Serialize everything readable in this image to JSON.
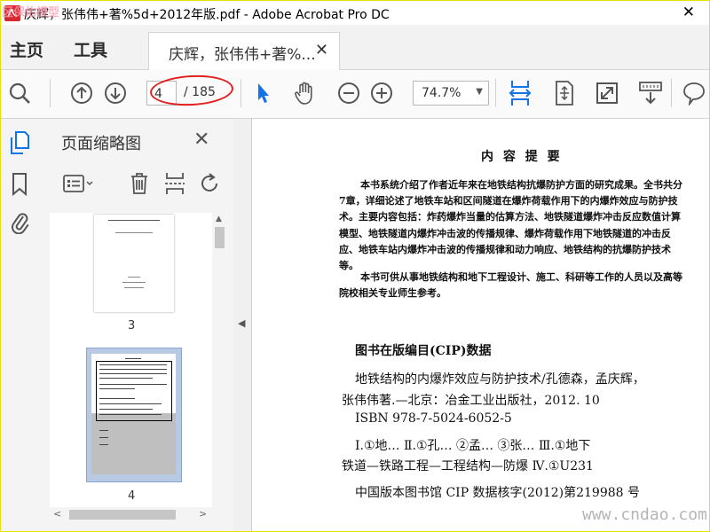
{
  "window": {
    "title": "庆辉，张伟伟+著%5d+2012年版.pdf - Adobe Acrobat Pro DC",
    "close_glyph": "✕",
    "watermark_top": "区保佑模型"
  },
  "tabs": {
    "home": "主页",
    "tools": "工具",
    "document": "庆辉，张伟伟+著%...",
    "close_glyph": "✕"
  },
  "toolbar": {
    "current_page": "4",
    "total_pages": "/ 185",
    "zoom": "74.7%",
    "icons": [
      "search-icon",
      "page-up-icon",
      "page-down-icon",
      "select-arrow-icon",
      "hand-icon",
      "zoom-out-icon",
      "zoom-in-icon",
      "fit-width-icon",
      "full-page-icon",
      "fullscreen-icon",
      "scroll-mode-icon",
      "comment-icon"
    ]
  },
  "left_rail": {
    "icons": [
      "pages-icon",
      "bookmark-icon",
      "attachment-icon"
    ]
  },
  "thumbnail_panel": {
    "title": "页面缩略图",
    "close_glyph": "✕",
    "tools": [
      "options-menu-icon",
      "trash-icon",
      "extract-icon",
      "rotate-icon"
    ],
    "pages": [
      {
        "number": "3",
        "heading": "地铁结构的内爆炸效应与防护技术"
      },
      {
        "number": "4",
        "heading": "内 容 提 要"
      }
    ]
  },
  "document": {
    "heading": "内 容 提 要",
    "paragraph1": "本书系统介绍了作者近年来在地铁结构抗爆防护方面的研究成果。全书共分7章，详细论述了地铁车站和区间隧道在爆炸荷载作用下的内爆炸效应与防护技术。主要内容包括：炸药爆炸当量的估算方法、地铁隧道爆炸冲击反应数值计算模型、地铁隧道内爆炸冲击波的传播规律、爆炸荷载作用下地铁隧道的冲击反应、地铁车站内爆炸冲击波的传播规律和动力响应、地铁结构的抗爆防护技术等。",
    "paragraph2": "本书可供从事地铁结构和地下工程设计、施工、科研等工作的人员以及高等院校相关专业师生参考。",
    "cip_title": "图书在版编目(CIP)数据",
    "cip_lines": [
      "地铁结构的内爆炸效应与防护技术/孔德森，孟庆辉，",
      "张伟伟著.—北京：冶金工业出版社，2012. 10",
      "ISBN 978-7-5024-6052-5",
      "Ⅰ.①地…  Ⅱ.①孔…  ②孟…  ③张…  Ⅲ.①地下",
      "铁道—铁路工程—工程结构—防爆  Ⅳ.①U231",
      "中国版本图书馆 CIP 数据核字(2012)第219988 号"
    ]
  },
  "watermark_bottom": "www.cndao.com",
  "colors": {
    "accent": "#1473e6",
    "annotation": "#e02020"
  }
}
